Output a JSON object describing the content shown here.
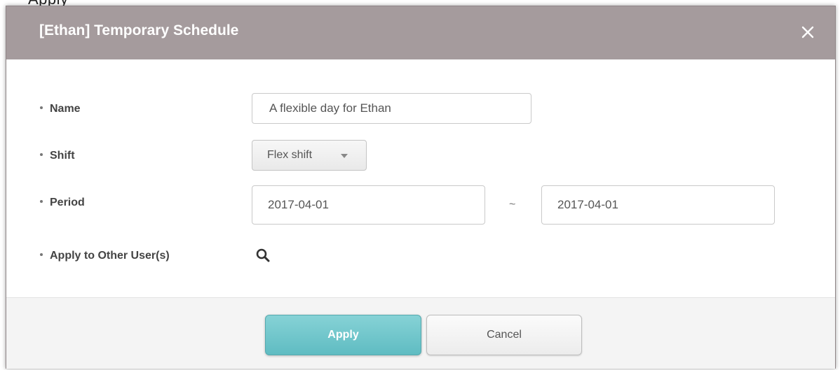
{
  "background_text": "Apply",
  "dialog": {
    "title": "[Ethan] Temporary Schedule",
    "close_icon": "close-icon"
  },
  "form": {
    "name": {
      "label": "Name",
      "value": "A flexible day for Ethan"
    },
    "shift": {
      "label": "Shift",
      "selected": "Flex shift",
      "icon": "chevron-down-icon"
    },
    "period": {
      "label": "Period",
      "start": "2017-04-01",
      "separator": "~",
      "end": "2017-04-01"
    },
    "apply_other": {
      "label": "Apply to Other User(s)",
      "icon": "search-icon"
    }
  },
  "footer": {
    "apply_label": "Apply",
    "cancel_label": "Cancel"
  },
  "colors": {
    "header_bg": "#a59b9d",
    "apply_bg": "#6cc4c9"
  }
}
